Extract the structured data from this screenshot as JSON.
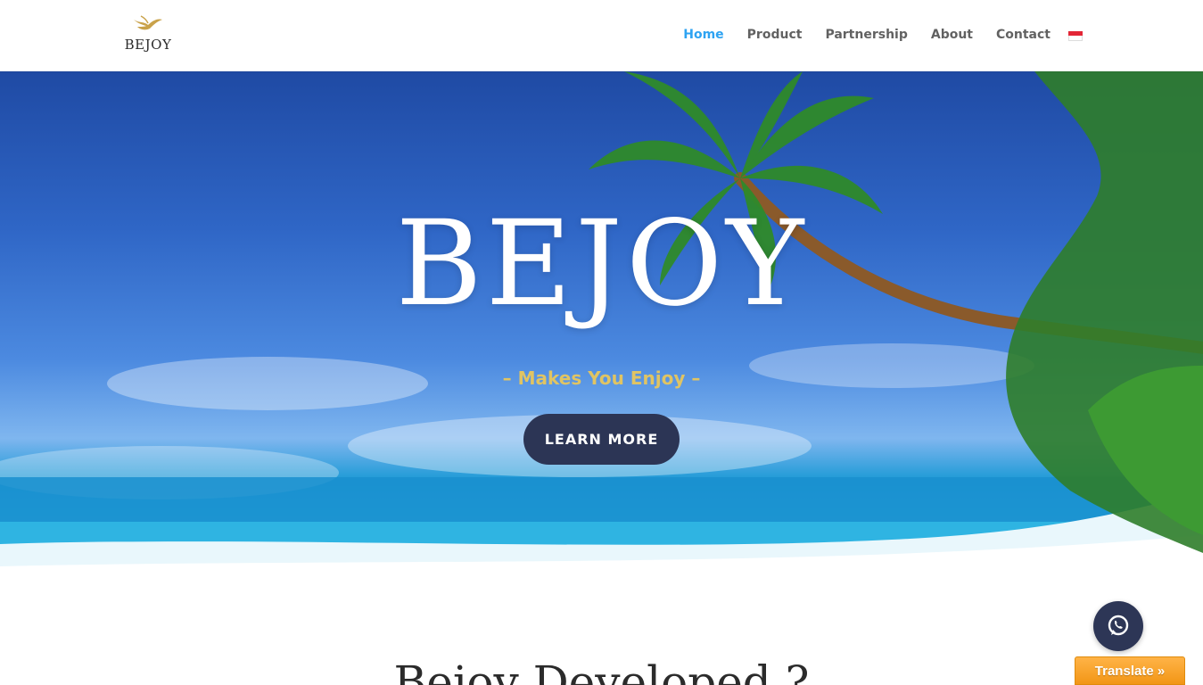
{
  "header": {
    "logo_text": "BEJOY",
    "nav": [
      {
        "label": "Home",
        "active": true
      },
      {
        "label": "Product",
        "active": false
      },
      {
        "label": "Partnership",
        "active": false
      },
      {
        "label": "About",
        "active": false
      },
      {
        "label": "Contact",
        "active": false
      }
    ],
    "language_flag": "indonesia-flag-icon",
    "active_color": "#2ea3f2"
  },
  "hero": {
    "title": "BEJOY",
    "tagline": "– Makes You Enjoy –",
    "button_label": "LEARN MORE",
    "tagline_color": "#e0c463",
    "button_color": "#2c3555"
  },
  "section": {
    "heading": "Bejoy Developed ?"
  },
  "widgets": {
    "whatsapp_icon": "whatsapp-icon",
    "translate_label": "Translate »"
  }
}
